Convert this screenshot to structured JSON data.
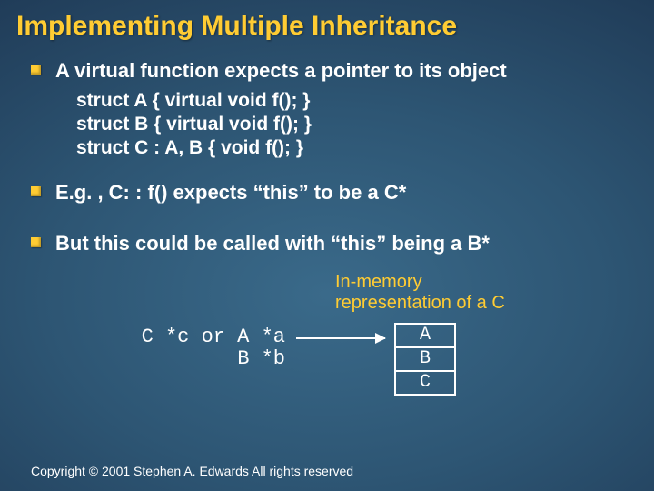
{
  "title": "Implementing Multiple Inheritance",
  "bullets": [
    {
      "text": "A virtual function expects a pointer to its object",
      "code": [
        "struct A { virtual void f(); }",
        "struct B { virtual void f(); }",
        "struct C : A, B { void f(); }"
      ]
    },
    {
      "text": "E.g. , C: : f() expects “this” to be a C*"
    },
    {
      "text": "But this could be called with “this” being a B*"
    }
  ],
  "diagram": {
    "caption_line1": "In-memory",
    "caption_line2": "representation of a C",
    "ptr_row1": "C *c or A *a",
    "ptr_row2": "B *b",
    "cells": [
      "A",
      "B",
      "C"
    ]
  },
  "copyright": "Copyright © 2001 Stephen A. Edwards  All rights reserved"
}
